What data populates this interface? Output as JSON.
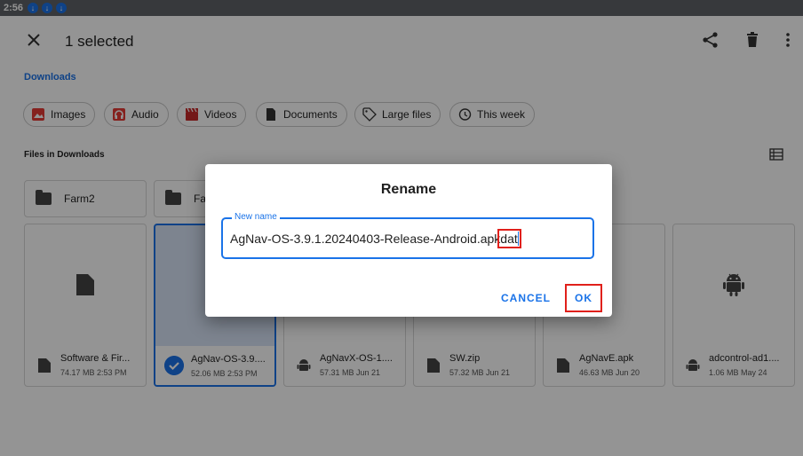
{
  "status_bar": {
    "time": "2:56",
    "download_badges": [
      "↓",
      "↓",
      "↓"
    ]
  },
  "toolbar": {
    "selection_title": "1 selected"
  },
  "breadcrumb": "Downloads",
  "chips": [
    {
      "label": "Images",
      "icon": "image-icon",
      "color": "#e53935"
    },
    {
      "label": "Audio",
      "icon": "headphones-icon",
      "color": "#e53935"
    },
    {
      "label": "Videos",
      "icon": "clapperboard-icon",
      "color": "#e53935"
    },
    {
      "label": "Documents",
      "icon": "document-icon",
      "color": "#333333"
    },
    {
      "label": "Large files",
      "icon": "tag-icon",
      "color": "#333333"
    },
    {
      "label": "This week",
      "icon": "history-icon",
      "color": "#333333"
    }
  ],
  "section_label": "Files in Downloads",
  "folders": [
    "Farm2",
    "Far"
  ],
  "files": [
    {
      "name": "Software & Fir...",
      "meta": "74.17 MB 2:53 PM",
      "type": "document"
    },
    {
      "name": "AgNav-OS-3.9....",
      "meta": "52.06 MB 2:53 PM",
      "type": "document",
      "selected": true
    },
    {
      "name": "AgNavX-OS-1....",
      "meta": "57.31 MB Jun 21",
      "type": "android"
    },
    {
      "name": "SW.zip",
      "meta": "57.32 MB Jun 21",
      "type": "document"
    },
    {
      "name": "AgNavE.apk",
      "meta": "46.63 MB Jun 20",
      "type": "document"
    },
    {
      "name": "adcontrol-ad1....",
      "meta": "1.06 MB May 24",
      "type": "android"
    }
  ],
  "dialog": {
    "title": "Rename",
    "field_label": "New name",
    "value_prefix": "AgNav-OS-3.9.1.20240403-Release-Android.apk",
    "value_selected": "dat",
    "cancel_label": "CANCEL",
    "ok_label": "OK"
  },
  "colors": {
    "accent": "#1a73e8",
    "highlight": "#e0201b",
    "scrim": "rgba(0,0,0,0.42)"
  }
}
